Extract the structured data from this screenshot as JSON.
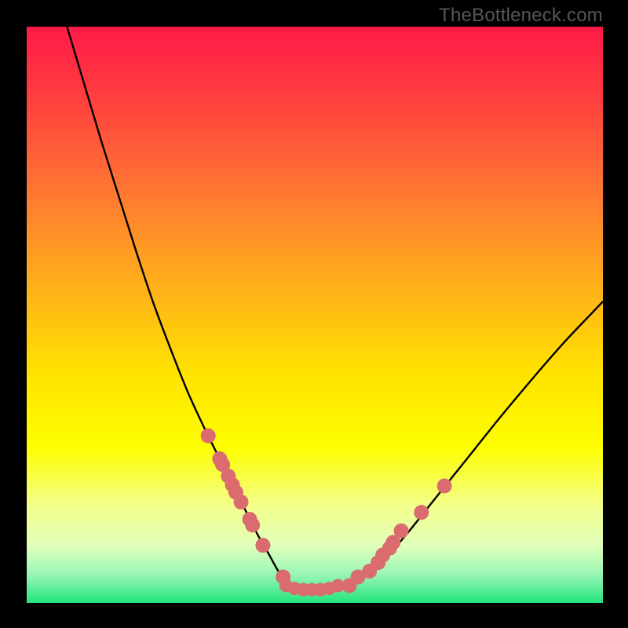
{
  "watermark": "TheBottleneck.com",
  "chart_data": {
    "type": "line",
    "title": "",
    "xlabel": "",
    "ylabel": "",
    "xlim": [
      0,
      100
    ],
    "ylim": [
      0,
      100
    ],
    "background_gradient": {
      "stops": [
        {
          "offset": 0.0,
          "color": "#ff1a48"
        },
        {
          "offset": 0.12,
          "color": "#ff3d3e"
        },
        {
          "offset": 0.28,
          "color": "#ff7534"
        },
        {
          "offset": 0.45,
          "color": "#ffb01a"
        },
        {
          "offset": 0.6,
          "color": "#ffe200"
        },
        {
          "offset": 0.73,
          "color": "#fdfe00"
        },
        {
          "offset": 0.83,
          "color": "#f4ff8a"
        },
        {
          "offset": 0.9,
          "color": "#e1ffba"
        },
        {
          "offset": 0.95,
          "color": "#9af6b6"
        },
        {
          "offset": 1.0,
          "color": "#23e57e"
        }
      ]
    },
    "series": [
      {
        "name": "curve",
        "type": "line",
        "x": [
          7.0,
          10.0,
          13.0,
          16.0,
          19.0,
          22.0,
          25.0,
          28.0,
          31.0,
          34.0,
          36.0,
          38.0,
          40.0,
          42.0,
          44.0,
          46.0,
          48.0,
          50.0,
          54.0,
          58.0,
          62.0,
          66.0,
          70.0,
          74.0,
          78.0,
          82.0,
          86.0,
          90.0,
          94.0,
          98.0,
          100.0
        ],
        "y": [
          100.0,
          90.0,
          80.0,
          70.5,
          61.0,
          52.0,
          44.0,
          36.5,
          30.0,
          24.0,
          20.0,
          16.0,
          12.0,
          8.5,
          5.0,
          3.0,
          2.2,
          2.0,
          2.3,
          4.0,
          7.5,
          12.0,
          17.0,
          22.0,
          27.0,
          32.0,
          36.8,
          41.5,
          46.0,
          50.2,
          52.3
        ]
      },
      {
        "name": "left-dots",
        "type": "scatter",
        "x": [
          31.5,
          33.5,
          34.0,
          35.0,
          35.7,
          36.3,
          37.2,
          38.7,
          39.2,
          41.0,
          44.5
        ],
        "y": [
          29.0,
          25.0,
          24.0,
          22.0,
          20.5,
          19.2,
          17.5,
          14.5,
          13.5,
          10.0,
          4.5
        ]
      },
      {
        "name": "right-dots",
        "type": "scatter",
        "x": [
          56.0,
          57.5,
          59.5,
          61.0,
          61.8,
          63.0,
          63.6,
          65.0,
          68.5,
          72.5
        ],
        "y": [
          3.0,
          4.5,
          5.5,
          7.0,
          8.3,
          9.5,
          10.5,
          12.5,
          15.7,
          20.3
        ]
      },
      {
        "name": "bottom-dots",
        "type": "scatter",
        "x": [
          45.0,
          46.5,
          48.0,
          49.5,
          51.0,
          52.5,
          54.0
        ],
        "y": [
          3.0,
          2.5,
          2.3,
          2.3,
          2.3,
          2.5,
          3.0
        ]
      }
    ],
    "colors": {
      "curve": "#000000",
      "dots_fill": "#da6c6f",
      "dots_stroke": "#c75659"
    }
  }
}
